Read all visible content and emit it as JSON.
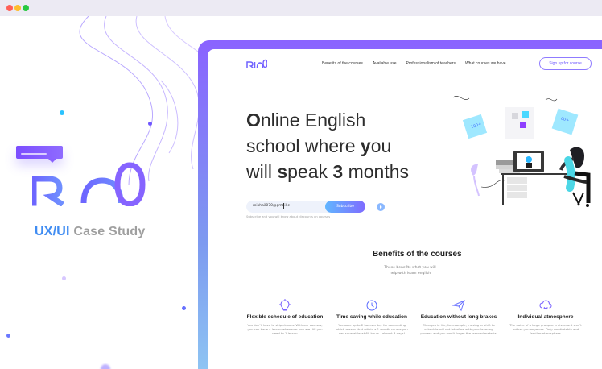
{
  "window": {
    "title": ""
  },
  "brand": {
    "name": "RIO"
  },
  "left_panel": {
    "case_study_prefix": "UX/UI",
    "case_study_suffix": " Case Study"
  },
  "nav": {
    "links": [
      "Benefits of the courses",
      "Available use",
      "Professionalism of teachers",
      "What courses we have"
    ],
    "signup_label": "Sign up for course"
  },
  "hero": {
    "line1_a": "O",
    "line1_b": "nline English",
    "line2_a": "school where ",
    "line2_b": "y",
    "line2_c": "ou",
    "line3_a": "will ",
    "line3_b": "s",
    "line3_c": "peak ",
    "line3_d": "3",
    "line3_e": " months"
  },
  "subscribe": {
    "email_value": "mikhail070@gmail.c",
    "button_label": "Subscribe",
    "note": "Subscribe and you will know about discounts on courses"
  },
  "benefits": {
    "title": "Benefits of the courses",
    "subtitle": "These benefits what you will help with learn english",
    "items": [
      {
        "icon": "lightbulb-icon",
        "title": "Flexible schedule of education",
        "text": "You don`t have to skip classes. With our courses, you can have a lesson whenever you are. All you need to 1 lesson"
      },
      {
        "icon": "clock-icon",
        "title": "Time saving while education",
        "text": "You save up to 2 hours a day for commuting which means that within a 1-month course you can save at least 60 hours - almost 3 days!"
      },
      {
        "icon": "paper-plane-icon",
        "title": "Education without long brakes",
        "text": "Changes in life, for example, moving or shift to schedule will not interfere with your learning process and you won't forget the learned material"
      },
      {
        "icon": "cloud-sync-icon",
        "title": "Individual atmosphere",
        "text": "The noise of a large group or a dissonant won't bother you anymore. Only comfortable and familiar atmosphere."
      }
    ]
  },
  "illustration": {
    "sticky_left": "100+",
    "sticky_right": "60+",
    "accents": [
      "#67c7f3",
      "#8c4dff",
      "#ff4d73",
      "#5db6ff"
    ]
  }
}
